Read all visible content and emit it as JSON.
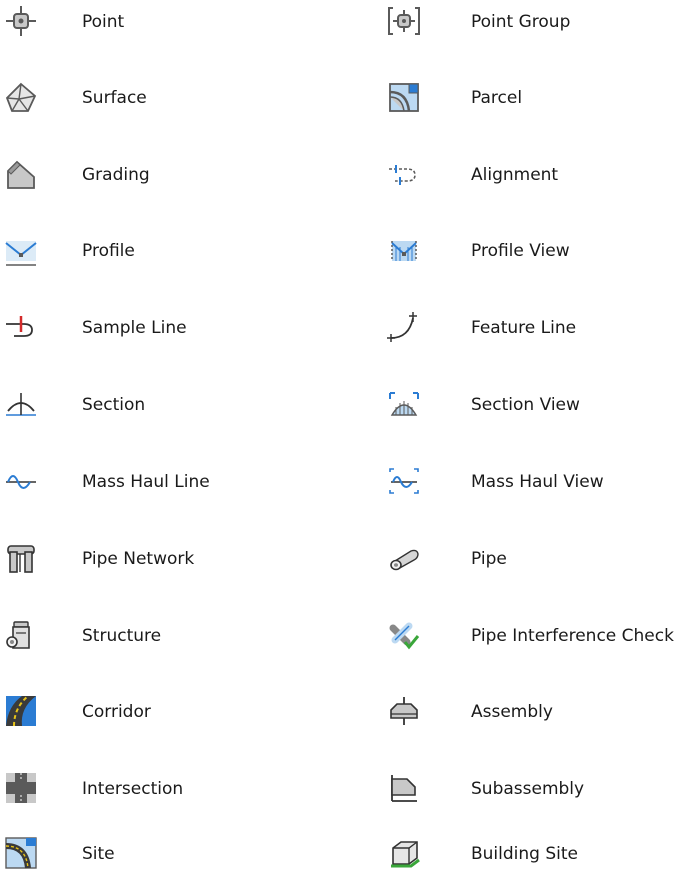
{
  "rows": [
    {
      "left": {
        "label": "Point",
        "icon": "point-icon"
      },
      "right": {
        "label": "Point Group",
        "icon": "point-group-icon"
      }
    },
    {
      "left": {
        "label": "Surface",
        "icon": "surface-icon"
      },
      "right": {
        "label": "Parcel",
        "icon": "parcel-icon"
      }
    },
    {
      "left": {
        "label": "Grading",
        "icon": "grading-icon"
      },
      "right": {
        "label": "Alignment",
        "icon": "alignment-icon"
      }
    },
    {
      "left": {
        "label": "Profile",
        "icon": "profile-icon"
      },
      "right": {
        "label": "Profile View",
        "icon": "profile-view-icon"
      }
    },
    {
      "left": {
        "label": "Sample Line",
        "icon": "sample-line-icon"
      },
      "right": {
        "label": "Feature Line",
        "icon": "feature-line-icon"
      }
    },
    {
      "left": {
        "label": "Section",
        "icon": "section-icon"
      },
      "right": {
        "label": "Section View",
        "icon": "section-view-icon"
      }
    },
    {
      "left": {
        "label": "Mass Haul Line",
        "icon": "mass-haul-line-icon"
      },
      "right": {
        "label": "Mass Haul View",
        "icon": "mass-haul-view-icon"
      }
    },
    {
      "left": {
        "label": "Pipe Network",
        "icon": "pipe-network-icon"
      },
      "right": {
        "label": "Pipe",
        "icon": "pipe-icon"
      }
    },
    {
      "left": {
        "label": "Structure",
        "icon": "structure-icon"
      },
      "right": {
        "label": "Pipe Interference Check",
        "icon": "pipe-interference-check-icon"
      }
    },
    {
      "left": {
        "label": "Corridor",
        "icon": "corridor-icon"
      },
      "right": {
        "label": "Assembly",
        "icon": "assembly-icon"
      }
    },
    {
      "left": {
        "label": "Intersection",
        "icon": "intersection-icon"
      },
      "right": {
        "label": "Subassembly",
        "icon": "subassembly-icon"
      }
    },
    {
      "left": {
        "label": "Site",
        "icon": "site-icon"
      },
      "right": {
        "label": "Building Site",
        "icon": "building-site-icon"
      }
    }
  ],
  "colors": {
    "outline": "#5a5a5a",
    "fill_gray": "#c8c8c8",
    "accent_blue": "#2b7cd3",
    "light_blue": "#bcd9f2",
    "accent_red": "#d42a2a",
    "accent_green": "#3aa63a",
    "corridor_dark": "#3a3a3a",
    "corridor_yellow": "#e8c418"
  }
}
